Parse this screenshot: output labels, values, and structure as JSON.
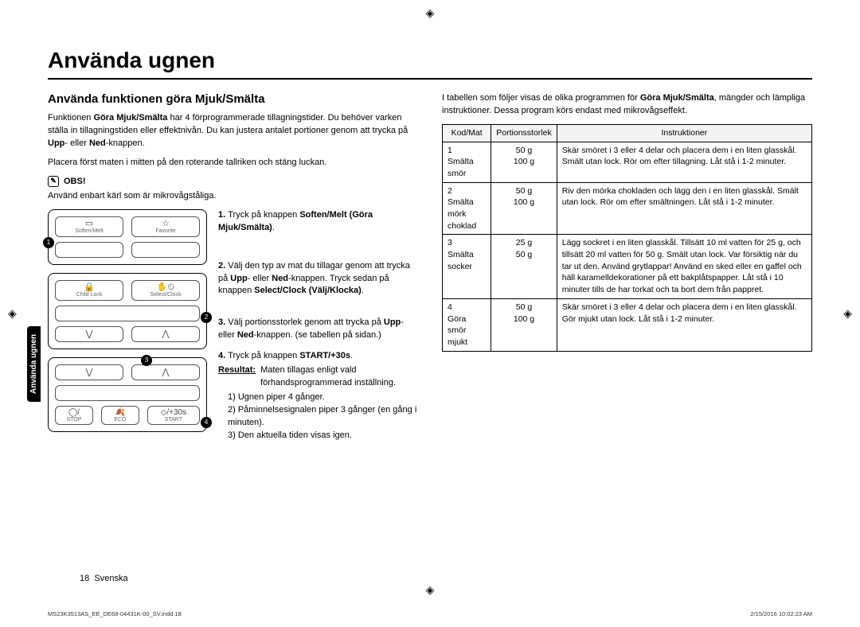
{
  "side_tab": "Använda ugnen",
  "crop_mark": "◈",
  "h1": "Använda ugnen",
  "left": {
    "h2": "Använda funktionen göra Mjuk/Smälta",
    "intro1a": "Funktionen ",
    "intro1b": "Göra Mjuk/Smälta",
    "intro1c": " har 4 förprogrammerade tillagningstider. Du behöver varken ställa in tillagningstiden eller effektnivån. Du kan justera antalet portioner genom att trycka på ",
    "intro1d": "Upp",
    "intro1e": "- eller ",
    "intro1f": "Ned",
    "intro1g": "-knappen.",
    "intro2": "Placera först maten i mitten på den roterande tallriken och stäng luckan.",
    "obs": "OBS!",
    "obs_text": "Använd enbart kärl som är mikrovågståliga.",
    "panelA": {
      "btn1": "Soften/Melt",
      "btn2": "Favorite"
    },
    "panelB": {
      "left_label": "Child Lock",
      "right_label": "Select/Clock"
    },
    "panelC": {
      "stop": "STOP",
      "eco": "ECO",
      "start": "START",
      "start30": "+30s"
    },
    "steps": {
      "s1a": "Tryck på knappen ",
      "s1b": "Soften/Melt (Göra Mjuk/Smälta)",
      "s1c": ".",
      "s2a": "Välj den typ av mat du tillagar genom att trycka på ",
      "s2b": "Upp",
      "s2c": "- eller ",
      "s2d": "Ned",
      "s2e": "-knappen. Tryck sedan på knappen ",
      "s2f": "Select/Clock (Välj/Klocka)",
      "s2g": ".",
      "s3a": "Välj portionsstorlek genom att trycka på ",
      "s3b": "Upp",
      "s3c": "- eller ",
      "s3d": "Ned",
      "s3e": "-knappen. (se tabellen på sidan.)",
      "s4a": "Tryck på knappen ",
      "s4b": "START/+30s",
      "s4c": ".",
      "res_label": "Resultat:",
      "res_text": "Maten tillagas enligt vald förhandsprogrammerad inställning.",
      "r1": "Ugnen piper 4 gånger.",
      "r2": "Påminnelsesignalen piper 3 gånger (en gång i minuten).",
      "r3": "Den aktuella tiden visas igen."
    }
  },
  "right": {
    "intro_a": "I tabellen som följer visas de olika programmen för ",
    "intro_b": "Göra Mjuk/Smälta",
    "intro_c": ", mängder och lämpliga instruktioner. Dessa program körs endast med mikrovågseffekt.",
    "table": {
      "head": [
        "Kod/Mat",
        "Portionsstorlek",
        "Instruktioner"
      ],
      "rows": [
        {
          "code": "1",
          "food": "Smälta smör",
          "size": [
            "50 g",
            "100 g"
          ],
          "instr": "Skär smöret i 3 eller 4 delar och placera dem i en liten glasskål. Smält utan lock. Rör om efter tillagning. Låt stå i 1-2 minuter."
        },
        {
          "code": "2",
          "food": "Smälta mörk choklad",
          "size": [
            "50 g",
            "100 g"
          ],
          "instr": "Riv den mörka chokladen och lägg den i en liten glasskål. Smält utan lock. Rör om efter smältningen. Låt stå i 1-2 minuter."
        },
        {
          "code": "3",
          "food": "Smälta socker",
          "size": [
            "25 g",
            "50 g"
          ],
          "instr": "Lägg sockret i en liten glasskål. Tillsätt 10 ml vatten för 25 g, och tillsätt 20 ml vatten för 50 g. Smält utan lock. Var försiktig när du tar ut den. Använd grytlappar! Använd en sked eller en gaffel och häll karamelldekorationer på ett bakplåtspapper. Låt stå i 10 minuter tills de har torkat och ta bort dem från pappret."
        },
        {
          "code": "4",
          "food": "Göra smör mjukt",
          "size": [
            "50 g",
            "100 g"
          ],
          "instr": "Skär smöret i 3 eller 4 delar och placera dem i en liten glasskål. Gör mjukt utan lock. Låt stå i 1-2 minuter."
        }
      ]
    }
  },
  "page_number": "18",
  "page_lang": "Svenska",
  "footer_left": "MS23K3513AS_EE_DE68-04431K-00_SV.indd   18",
  "footer_right": "2/15/2016   10:02:23 AM"
}
